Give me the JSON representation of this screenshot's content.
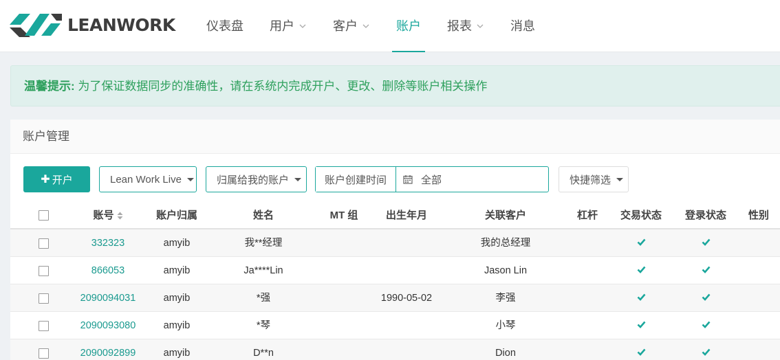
{
  "brand": {
    "name": "LEANWORK"
  },
  "nav": [
    {
      "label": "仪表盘",
      "chevron": false,
      "active": false
    },
    {
      "label": "用户",
      "chevron": true,
      "active": false
    },
    {
      "label": "客户",
      "chevron": true,
      "active": false
    },
    {
      "label": "账户",
      "chevron": false,
      "active": true
    },
    {
      "label": "报表",
      "chevron": true,
      "active": false
    },
    {
      "label": "消息",
      "chevron": false,
      "active": false
    }
  ],
  "alert": {
    "title": "温馨提示:",
    "text": " 为了保证数据同步的准确性，请在系统内完成开户、更改、删除等账户相关操作"
  },
  "panel": {
    "title": "账户管理"
  },
  "toolbar": {
    "open_label": "开户",
    "platform_value": "Lean Work Live",
    "owner_value": "归属给我的账户",
    "date_label": "账户创建时间",
    "date_value": "全部",
    "quick_filter_label": "快捷筛选"
  },
  "table": {
    "columns": [
      "账号",
      "账户归属",
      "姓名",
      "MT 组",
      "出生年月",
      "关联客户",
      "杠杆",
      "交易状态",
      "登录状态",
      "性别"
    ],
    "rows": [
      {
        "account": "332323",
        "owner": "amyib",
        "name": "我**经理",
        "mt_group": "",
        "birth": "",
        "client": "我的总经理",
        "leverage": "",
        "trade_ok": true,
        "login_ok": true,
        "gender": ""
      },
      {
        "account": "866053",
        "owner": "amyib",
        "name": "Ja****Lin",
        "mt_group": "",
        "birth": "",
        "client": "Jason Lin",
        "leverage": "",
        "trade_ok": true,
        "login_ok": true,
        "gender": ""
      },
      {
        "account": "2090094031",
        "owner": "amyib",
        "name": "*强",
        "mt_group": "",
        "birth": "1990-05-02",
        "client": "李强",
        "leverage": "",
        "trade_ok": true,
        "login_ok": true,
        "gender": ""
      },
      {
        "account": "2090093080",
        "owner": "amyib",
        "name": "*琴",
        "mt_group": "",
        "birth": "",
        "client": "小琴",
        "leverage": "",
        "trade_ok": true,
        "login_ok": true,
        "gender": ""
      },
      {
        "account": "2090092899",
        "owner": "amyib",
        "name": "D**n",
        "mt_group": "",
        "birth": "",
        "client": "Dion",
        "leverage": "",
        "trade_ok": true,
        "login_ok": true,
        "gender": ""
      }
    ]
  },
  "colors": {
    "accent": "#1aa79c",
    "link": "#1a9a8f",
    "alert_text": "#2ea05d",
    "alert_bg": "#e0f0ed"
  }
}
